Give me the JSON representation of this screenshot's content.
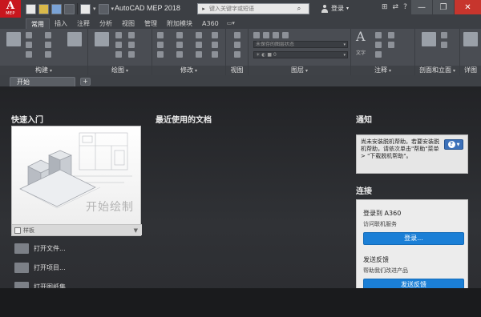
{
  "titlebar": {
    "logo_letter": "A",
    "logo_sub": "MEP",
    "title": "AutoCAD MEP 2018",
    "search_placeholder": "键入关键字或短语",
    "login_label": "登录",
    "min_symbol": "—",
    "max_symbol": "❐",
    "close_symbol": "✕"
  },
  "ribbon_tabs": [
    "常用",
    "插入",
    "注释",
    "分析",
    "视图",
    "管理",
    "附加模块",
    "A360"
  ],
  "ribbon_panels": {
    "build": "构建",
    "draw": "绘图",
    "modify": "修改",
    "view": "视图",
    "layers": "图层",
    "annotation": "注释",
    "section_elevation": "剖面和立面",
    "detail": "详图",
    "unsaved_layer_state": "未保存的图层状态",
    "text_label": "文字"
  },
  "doc_tabs": {
    "start_tab": "开始",
    "add_symbol": "+"
  },
  "start_page": {
    "quick_start_title": "快速入门",
    "recent_docs_title": "最近使用的文档",
    "notify_title": "通知",
    "connect_title": "连接",
    "begin_drawing": "开始绘制",
    "template_label": "样板",
    "links": [
      "打开文件...",
      "打开项目...",
      "打开图纸集..."
    ],
    "notify_text": "尚未安装脱机帮助。若要安装脱机帮助，请依次单击\"帮助\"菜单 > \"下载脱机帮助\"。",
    "connect": {
      "signin_title": "登录到 A360",
      "signin_sub": "访问联机服务",
      "signin_button": "登录...",
      "feedback_title": "发送反馈",
      "feedback_sub": "帮助我们改进产品",
      "feedback_button": "发送反馈"
    }
  },
  "colors": {
    "accent_blue": "#1b7fd6",
    "logo_red": "#c8171e",
    "help_blue": "#3b70b9"
  }
}
